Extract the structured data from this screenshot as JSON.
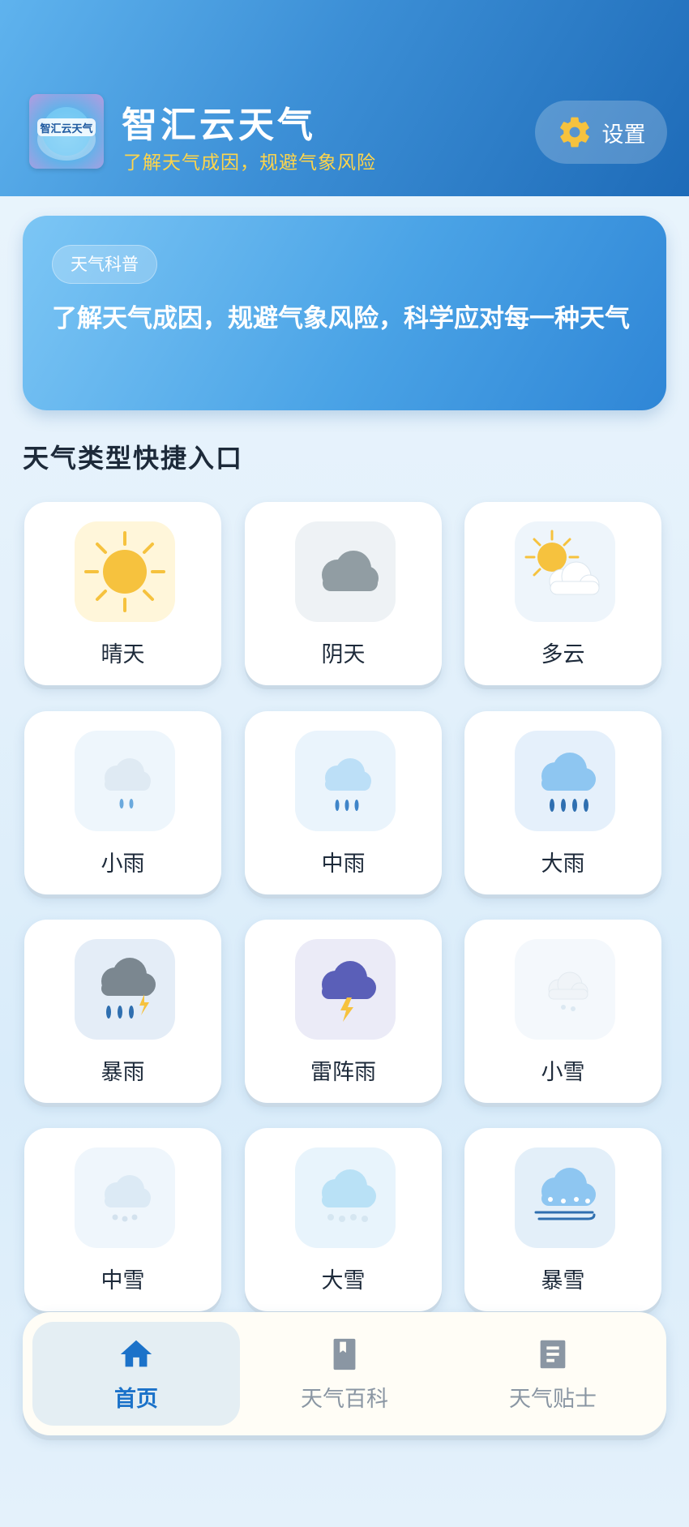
{
  "header": {
    "title": "智汇云天气",
    "subtitle": "了解天气成因，规避气象风险",
    "logo_text": "智汇云天气",
    "settings_label": "设置",
    "settings_icon": "gear-icon"
  },
  "banner": {
    "tag": "天气科普",
    "text": "了解天气成因，规避气象风险，科学应对每一种天气"
  },
  "section": {
    "title": "天气类型快捷入口"
  },
  "weather_types": [
    {
      "label": "晴天",
      "icon": "sunny-icon"
    },
    {
      "label": "阴天",
      "icon": "overcast-icon"
    },
    {
      "label": "多云",
      "icon": "partly-cloudy-icon"
    },
    {
      "label": "小雨",
      "icon": "light-rain-icon"
    },
    {
      "label": "中雨",
      "icon": "moderate-rain-icon"
    },
    {
      "label": "大雨",
      "icon": "heavy-rain-icon"
    },
    {
      "label": "暴雨",
      "icon": "rainstorm-icon"
    },
    {
      "label": "雷阵雨",
      "icon": "thunderstorm-icon"
    },
    {
      "label": "小雪",
      "icon": "light-snow-icon"
    },
    {
      "label": "中雪",
      "icon": "moderate-snow-icon"
    },
    {
      "label": "大雪",
      "icon": "heavy-snow-icon"
    },
    {
      "label": "暴雪",
      "icon": "blizzard-icon"
    }
  ],
  "nav": {
    "items": [
      {
        "label": "首页",
        "icon": "home-icon",
        "active": true
      },
      {
        "label": "天气百科",
        "icon": "book-icon",
        "active": false
      },
      {
        "label": "天气贴士",
        "icon": "notes-icon",
        "active": false
      }
    ]
  },
  "colors": {
    "header_start": "#5fb3ee",
    "header_end": "#1e6bb8",
    "subtitle": "#ffd54a",
    "accent": "#1b72c9",
    "sun": "#f6c23e"
  }
}
